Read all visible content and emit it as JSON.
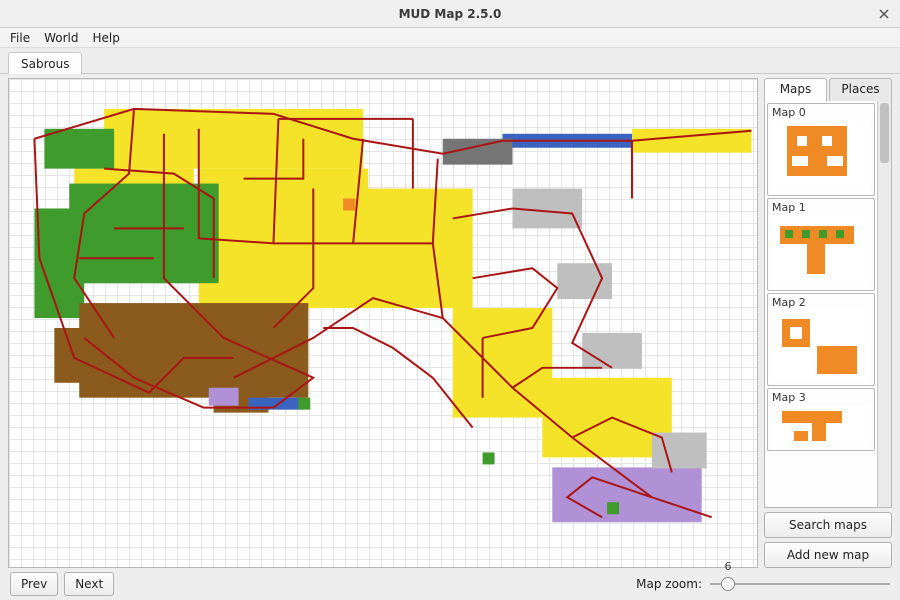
{
  "window": {
    "title": "MUD Map 2.5.0"
  },
  "menu": {
    "file": "File",
    "world": "World",
    "help": "Help"
  },
  "tabs": {
    "main": "Sabrous"
  },
  "sidepanel": {
    "tabs": {
      "maps": "Maps",
      "places": "Places"
    },
    "maps": [
      {
        "label": "Map 0"
      },
      {
        "label": "Map 1"
      },
      {
        "label": "Map 2"
      },
      {
        "label": "Map 3"
      }
    ],
    "search_btn": "Search maps",
    "add_btn": "Add new map"
  },
  "bottom": {
    "prev": "Prev",
    "next": "Next",
    "zoom_label": "Map zoom:",
    "zoom_value": "6"
  },
  "colors": {
    "pathline": "#aa1414",
    "yellow": "#f4e328",
    "green": "#3e9b2c",
    "brown": "#8a5b1c",
    "purple": "#b091d6",
    "blue": "#3b63c0",
    "grey": "#bfbfbf",
    "orange": "#f08a24"
  }
}
